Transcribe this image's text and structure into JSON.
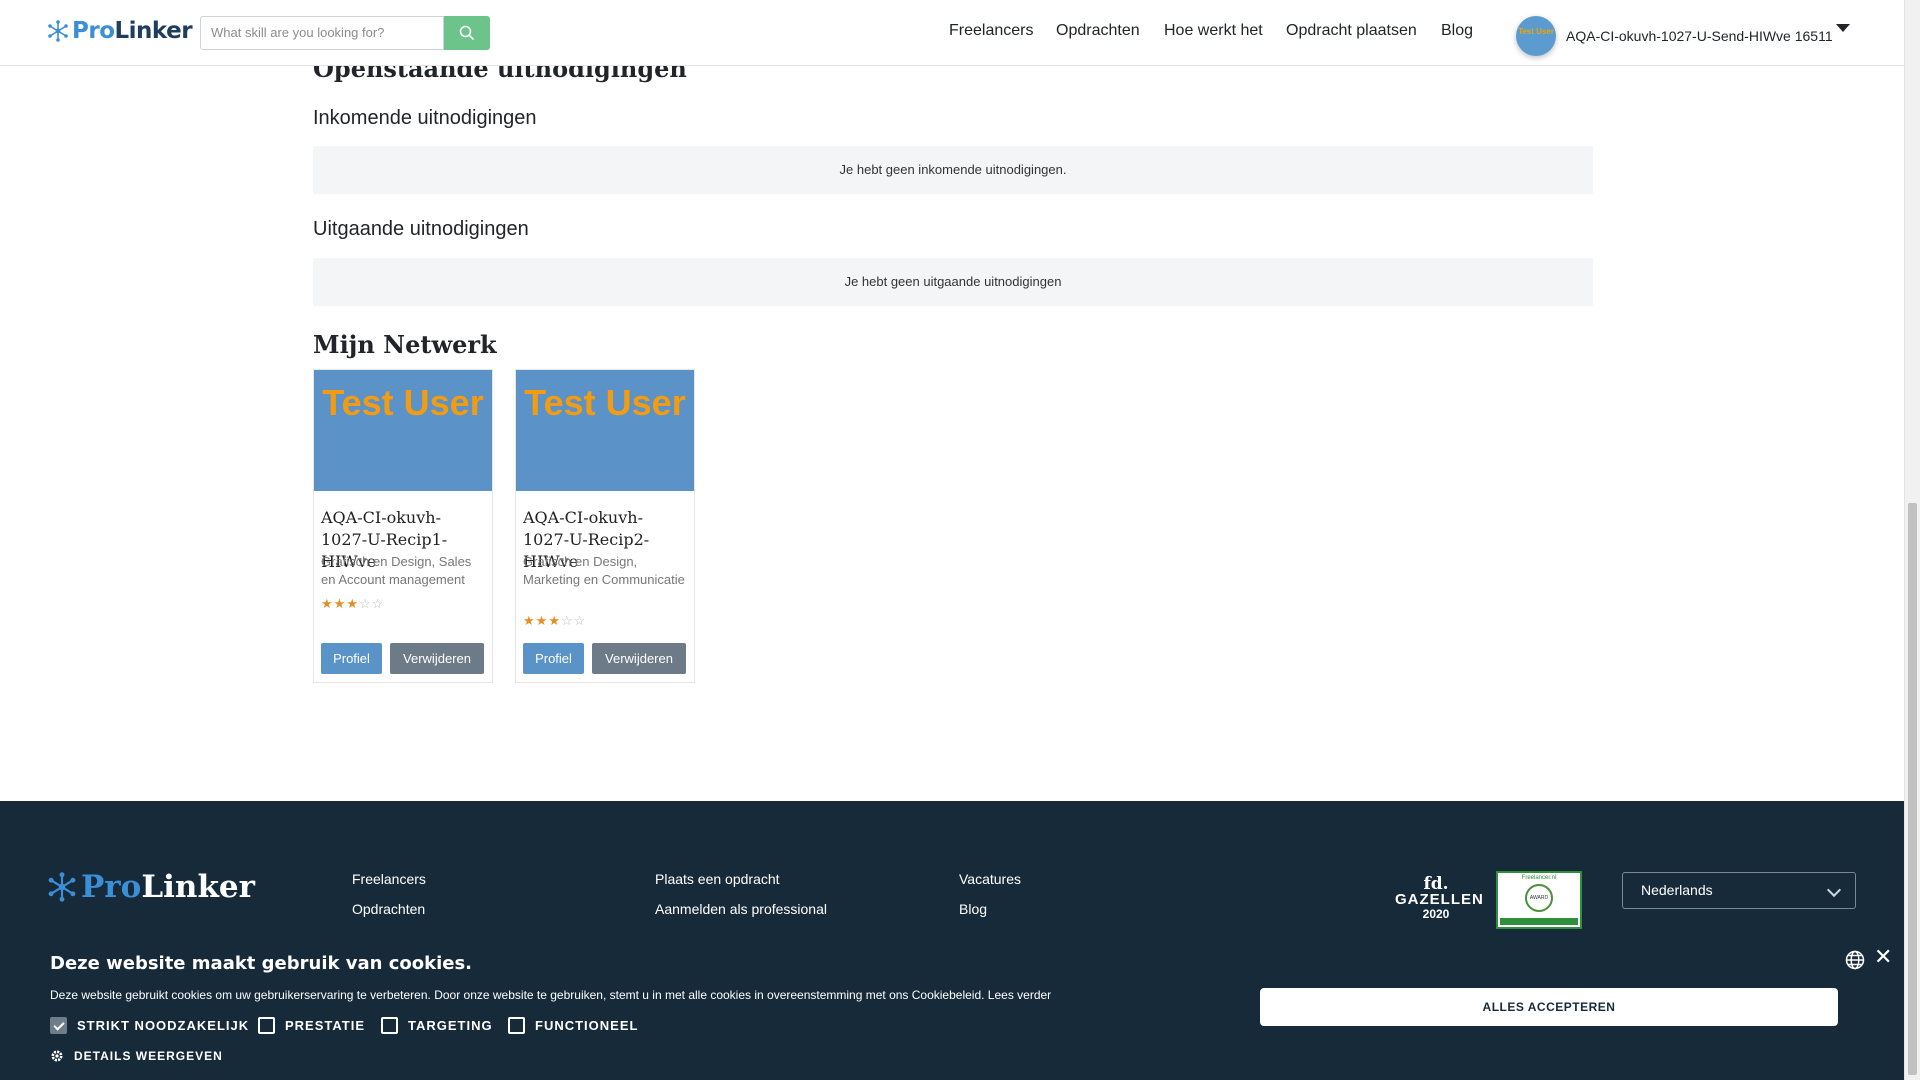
{
  "header": {
    "logo_pro": "Pro",
    "logo_linker": "Linker",
    "search_placeholder": "What skill are you looking for?",
    "nav": [
      "Freelancers",
      "Opdrachten",
      "Hoe werkt het",
      "Opdracht plaatsen",
      "Blog"
    ],
    "avatar_text": "Test User",
    "username": "AQA-CI-okuvh-1027-U-Send-HIWve 16511"
  },
  "main": {
    "open_invitations_title": "Openstaande uitnodigingen",
    "incoming_title": "Inkomende uitnodigingen",
    "incoming_empty": "Je hebt geen inkomende uitnodigingen.",
    "outgoing_title": "Uitgaande uitnodigingen",
    "outgoing_empty": "Je hebt geen uitgaande uitnodigingen",
    "network_title": "Mijn Netwerk",
    "cards": [
      {
        "image_text": "Test User",
        "name": "AQA-CI-okuvh-1027-U-Recip1-HIWve",
        "skills": "Grafisch en Design, Sales en Account management",
        "rating": 3,
        "rating_max": 5,
        "profile_label": "Profiel",
        "remove_label": "Verwijderen"
      },
      {
        "image_text": "Test User",
        "name": "AQA-CI-okuvh-1027-U-Recip2-HIWve",
        "skills": "Grafisch en Design, Marketing en Communicatie",
        "rating": 3,
        "rating_max": 5,
        "profile_label": "Profiel",
        "remove_label": "Verwijderen"
      }
    ]
  },
  "footer": {
    "logo_pro": "Pro",
    "logo_linker": "Linker",
    "col1": [
      "Freelancers",
      "Opdrachten"
    ],
    "col2": [
      "Plaats een opdracht",
      "Aanmelden als professional"
    ],
    "col3": [
      "Vacatures",
      "Blog"
    ],
    "fd_line1": "fd.",
    "fd_line2": "GAZELLEN",
    "fd_year": "2020",
    "badge_top": "Freelancer.nl",
    "badge_ring": "AWARD",
    "language": "Nederlands"
  },
  "cookie": {
    "title": "Deze website maakt gebruik van cookies.",
    "text": "Deze website gebruikt cookies om uw gebruikerservaring te verbeteren. Door onze website te gebruiken, stemt u in met alle cookies in overeenstemming met ons Cookiebeleid. Lees verder",
    "options": [
      {
        "label": "STRIKT NOODZAKELIJK",
        "checked": true
      },
      {
        "label": "PRESTATIE",
        "checked": false
      },
      {
        "label": "TARGETING",
        "checked": false
      },
      {
        "label": "FUNCTIONEEL",
        "checked": false
      }
    ],
    "details_label": "DETAILS WEERGEVEN",
    "accept_label": "ALLES ACCEPTEREN"
  },
  "colors": {
    "brand_blue": "#3a8fd6",
    "navy": "#172a3a",
    "search_green": "#6cc48b",
    "star": "#e58e26"
  }
}
